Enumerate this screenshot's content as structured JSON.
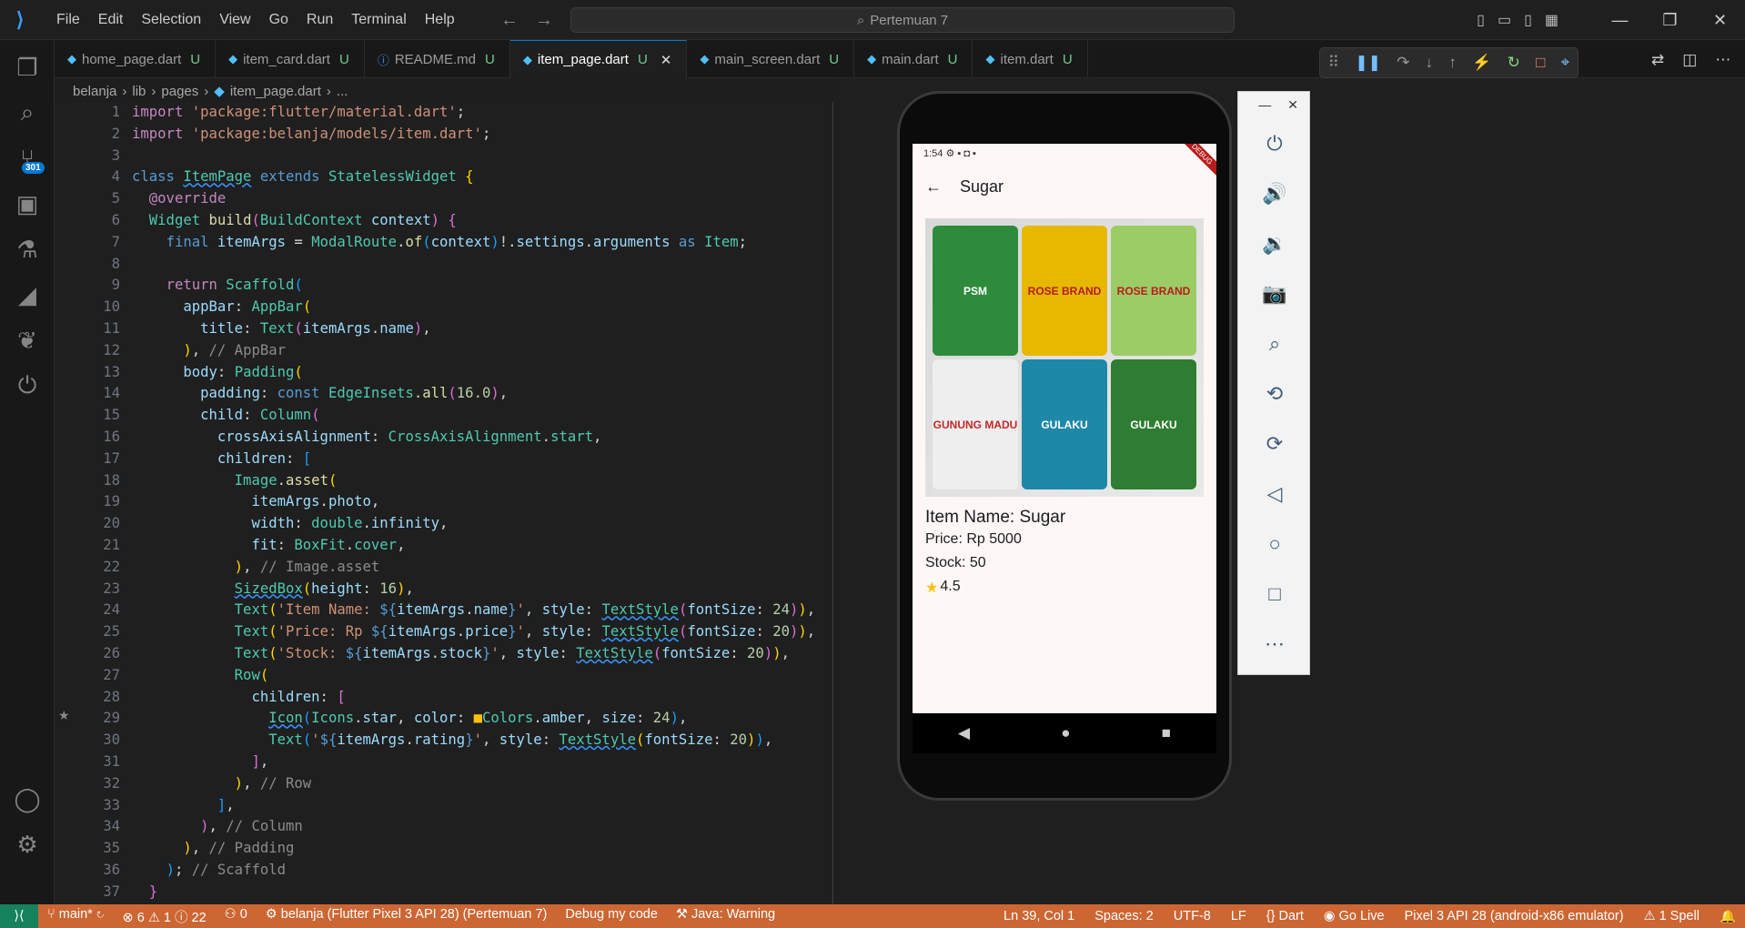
{
  "menu": [
    "File",
    "Edit",
    "Selection",
    "View",
    "Go",
    "Run",
    "Terminal",
    "Help"
  ],
  "search": "Pertemuan 7",
  "tabs": [
    {
      "name": "home_page.dart",
      "status": "U"
    },
    {
      "name": "item_card.dart",
      "status": "U"
    },
    {
      "name": "README.md",
      "status": "U"
    },
    {
      "name": "item_page.dart",
      "status": "U",
      "active": true
    },
    {
      "name": "main_screen.dart",
      "status": "U"
    },
    {
      "name": "main.dart",
      "status": "U"
    },
    {
      "name": "item.dart",
      "status": "U"
    }
  ],
  "breadcrumb": {
    "a": "belanja",
    "b": "lib",
    "c": "pages",
    "d": "item_page.dart",
    "e": "..."
  },
  "scm_badge": "301",
  "phone": {
    "time": "1:54",
    "title": "Sugar",
    "item_name": "Item Name: Sugar",
    "price": "Price: Rp 5000",
    "stock": "Stock: 50",
    "rating": "4.5",
    "pkg_labels": [
      "PSM",
      "ROSE BRAND",
      "ROSE BRAND",
      "GUNUNG MADU",
      "GULAKU",
      "GULAKU"
    ],
    "debug": "DEBUG"
  },
  "status": {
    "branch": "main*",
    "errors": "6",
    "warnings": "1",
    "info": "22",
    "ports": "0",
    "launch": "belanja (Flutter Pixel 3 API 28) (Pertemuan 7)",
    "debug": "Debug my code",
    "java": "Java: Warning",
    "pos": "Ln 39, Col 1",
    "spaces": "Spaces: 2",
    "enc": "UTF-8",
    "eol": "LF",
    "lang": "Dart",
    "live": "Go Live",
    "device": "Pixel 3 API 28 (android-x86 emulator)",
    "spell": "1 Spell"
  }
}
